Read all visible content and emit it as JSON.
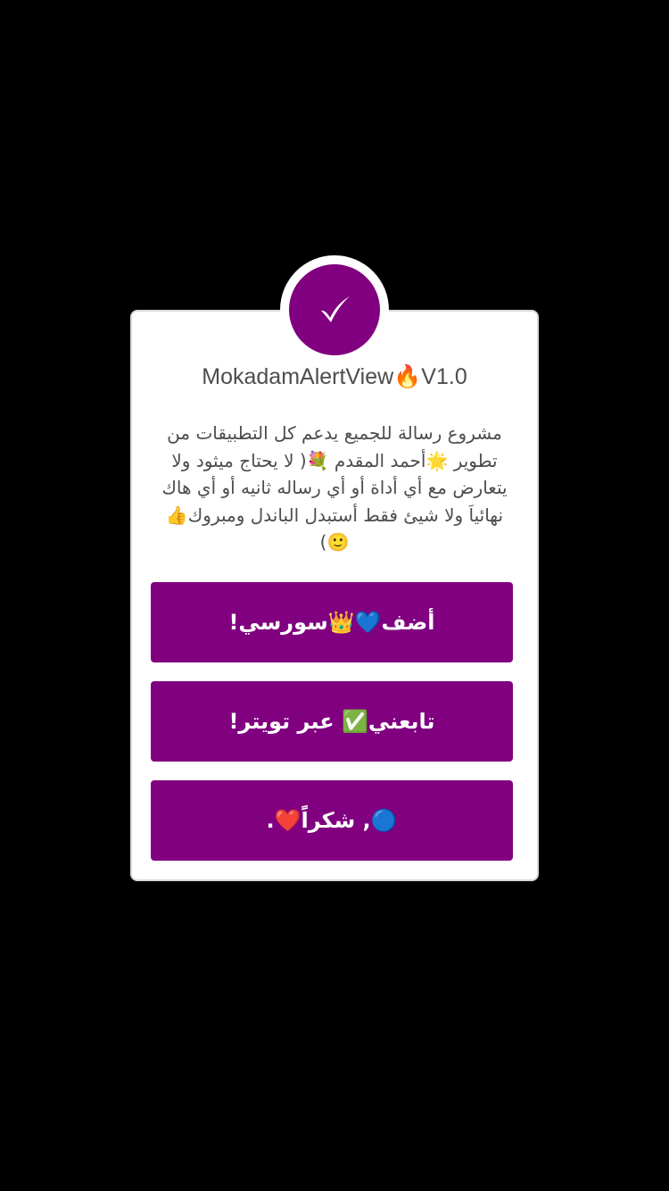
{
  "alert": {
    "title": "MokadamAlertView🔥V1.0",
    "message": "مشروع رسالة للجميع يدعم كل التطبيقات من تطوير 🌟أحمد المقدم 💐( لا يحتاج ميثود ولا يتعارض مع أي أداة أو أي رساله ثانيه أو أي هاك نهائياَ ولا شيئ فقط أستبدل الباندل ومبروك👍🙂)",
    "icon": "checkmark-icon",
    "accent_color": "#800080",
    "buttons": [
      {
        "label": "أضف💙👑سورسي!"
      },
      {
        "label": "تابعني✅ عبر تويتر!"
      },
      {
        "label": "🔵, شكراً❤️."
      }
    ]
  }
}
